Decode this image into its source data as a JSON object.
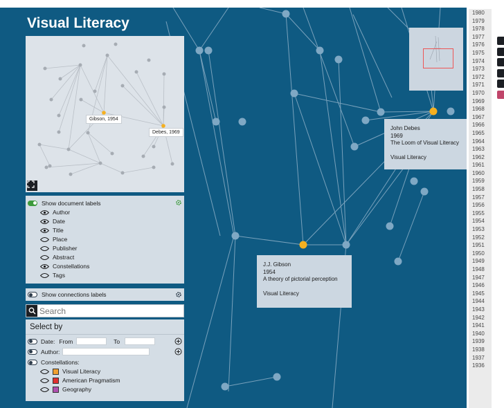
{
  "app": {
    "title": "Visual Literacy"
  },
  "mini_graph": {
    "labels": [
      "Gibson, 1954",
      "Debes, 1969"
    ]
  },
  "labels_panel": {
    "show_document_labels": "Show document labels",
    "options": [
      {
        "label": "Author",
        "visible": true
      },
      {
        "label": "Date",
        "visible": true
      },
      {
        "label": "Title",
        "visible": true
      },
      {
        "label": "Place",
        "visible": false
      },
      {
        "label": "Publisher",
        "visible": false
      },
      {
        "label": "Abstract",
        "visible": false
      },
      {
        "label": "Constellations",
        "visible": true
      },
      {
        "label": "Tags",
        "visible": false
      }
    ]
  },
  "connections_panel": {
    "label": "Show connections labels"
  },
  "search": {
    "placeholder": "Search"
  },
  "select_panel": {
    "title": "Select by",
    "date_label": "Date:",
    "from_label": "From",
    "to_label": "To",
    "author_label": "Author:",
    "constellations_label": "Constellations:",
    "constellations": [
      {
        "label": "Visual Literacy",
        "color": "#f0a030"
      },
      {
        "label": "American Pragmatism",
        "color": "#e03030"
      },
      {
        "label": "Geography",
        "color": "#b050b0"
      }
    ]
  },
  "tooltips": {
    "debes": {
      "author": "John Debes",
      "year": "1969",
      "title": "The Loom of Visual Literacy",
      "constellation": "Visual Literacy"
    },
    "gibson": {
      "author": "J.J. Gibson",
      "year": "1954",
      "title": "A theory of pictorial perception",
      "constellation": "Visual Literacy"
    }
  },
  "timeline": {
    "years": [
      "1980",
      "1979",
      "1978",
      "1977",
      "1976",
      "1975",
      "1974",
      "1973",
      "1972",
      "1971",
      "1970",
      "1969",
      "1968",
      "1967",
      "1966",
      "1965",
      "1964",
      "1963",
      "1962",
      "1961",
      "1960",
      "1959",
      "1958",
      "1957",
      "1956",
      "1955",
      "1954",
      "1953",
      "1952",
      "1951",
      "1950",
      "1949",
      "1948",
      "1947",
      "1946",
      "1945",
      "1944",
      "1943",
      "1942",
      "1941",
      "1940",
      "1939",
      "1938",
      "1937",
      "1936"
    ]
  },
  "colors": {
    "canvas_bg": "#0f5a82",
    "highlight_node": "#f5b020",
    "node": "#7fa8c4"
  },
  "toolbar_icons": [
    "select-icon",
    "fit-icon",
    "zoom-in-icon",
    "zoom-out-icon",
    "cube-icon",
    "reset-icon"
  ]
}
